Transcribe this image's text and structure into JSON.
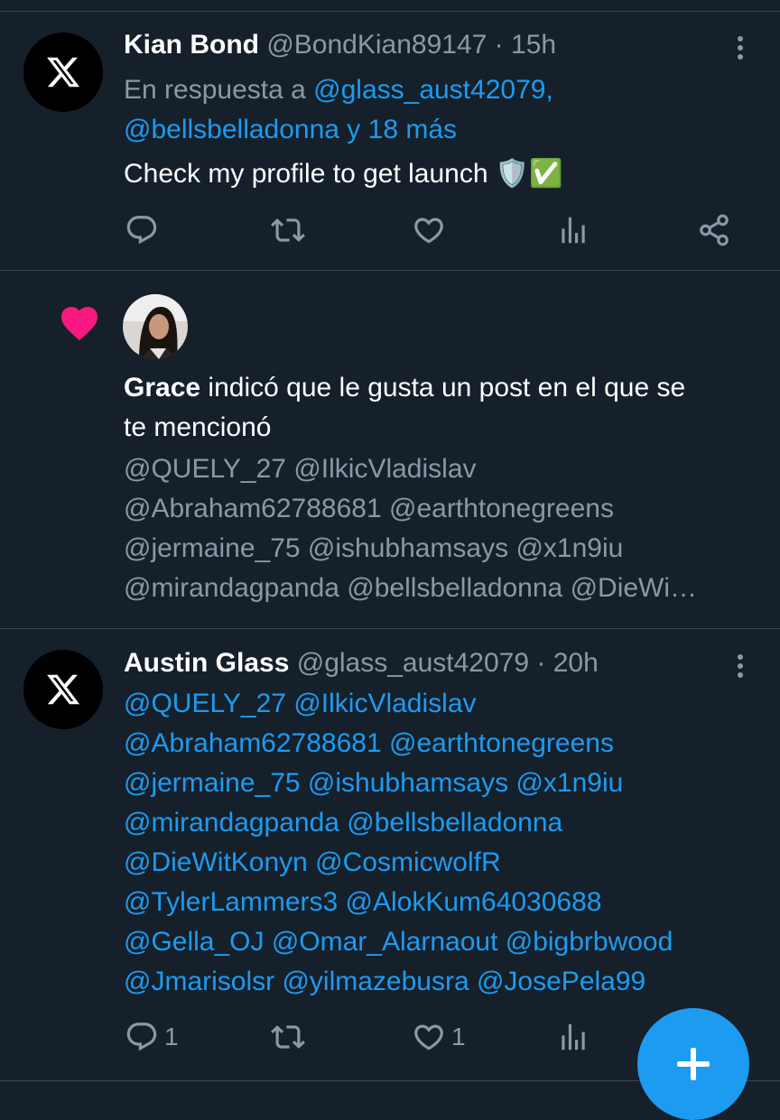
{
  "tweet1": {
    "name": "Kian Bond",
    "handle": "@BondKian89147",
    "sep": "·",
    "time": "15h",
    "reply_prefix": "En respuesta a",
    "reply_line1": "@glass_aust42079,",
    "reply_line2": "@bellsbelladonna y 18 más",
    "body": "Check my profile to get launch 🛡️✅",
    "icon": "x-logo-icon"
  },
  "notification": {
    "name": "Grace",
    "text_line1_rest": "indicó que le gusta un post en el que se",
    "text_line2": "te mencionó",
    "mentions": [
      "@QUELY_27 @IlkicVladislav",
      "@Abraham62788681 @earthtonegreens",
      "@jermaine_75 @ishubhamsays @x1n9iu",
      "@mirandagpanda @bellsbelladonna @DieWi…"
    ],
    "icon": "heart-icon"
  },
  "tweet2": {
    "name": "Austin Glass",
    "handle": "@glass_aust42079",
    "sep": "·",
    "time": "20h",
    "mention_lines": [
      "@QUELY_27 @IlkicVladislav",
      "@Abraham62788681 @earthtonegreens",
      "@jermaine_75 @ishubhamsays @x1n9iu",
      "@mirandagpanda @bellsbelladonna",
      "@DieWitKonyn @CosmicwolfR",
      "@TylerLammers3 @AlokKum64030688",
      "@Gella_OJ @Omar_Alarnaout @bigbrbwood",
      "@Jmarisolsr @yilmazebusra @JosePela99"
    ],
    "reply_count": "1",
    "like_count": "1",
    "icon": "x-logo-icon"
  },
  "fab": {
    "icon": "plus-icon"
  },
  "colors": {
    "background": "#15202b",
    "divider": "#38444d",
    "muted": "#8b98a5",
    "accent": "#1d9bf0",
    "heart": "#f91880"
  }
}
